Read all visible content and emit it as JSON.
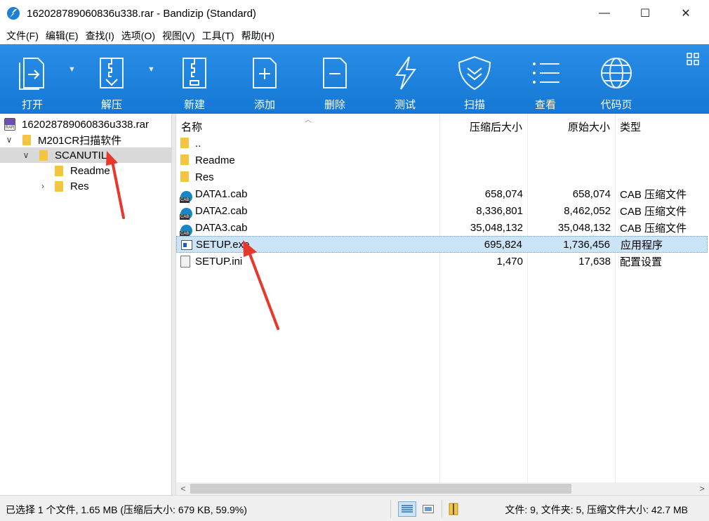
{
  "window": {
    "title": "162028789060836u338.rar - Bandizip (Standard)",
    "min_glyph": "—",
    "max_glyph": "☐",
    "close_glyph": "✕"
  },
  "menu": [
    "文件(F)",
    "编辑(E)",
    "查找(I)",
    "选项(O)",
    "视图(V)",
    "工具(T)",
    "帮助(H)"
  ],
  "toolbar": {
    "open": "打开",
    "extract": "解压",
    "new": "新建",
    "add": "添加",
    "delete": "删除",
    "test": "测试",
    "scan": "扫描",
    "view": "查看",
    "codepage": "代码页"
  },
  "tree": {
    "archive": "162028789060836u338.rar",
    "root_folder": "M201CR扫描软件",
    "selected_folder": "SCANUTIL",
    "children": [
      "Readme",
      "Res"
    ]
  },
  "columns": {
    "name": "名称",
    "compressed": "压缩后大小",
    "original": "原始大小",
    "type": "类型"
  },
  "files": [
    {
      "name": "..",
      "compressed": "",
      "original": "",
      "type": "",
      "icon": "folder"
    },
    {
      "name": "Readme",
      "compressed": "",
      "original": "",
      "type": "",
      "icon": "folder"
    },
    {
      "name": "Res",
      "compressed": "",
      "original": "",
      "type": "",
      "icon": "folder"
    },
    {
      "name": "DATA1.cab",
      "compressed": "658,074",
      "original": "658,074",
      "type": "CAB 压缩文件",
      "icon": "cab"
    },
    {
      "name": "DATA2.cab",
      "compressed": "8,336,801",
      "original": "8,462,052",
      "type": "CAB 压缩文件",
      "icon": "cab"
    },
    {
      "name": "DATA3.cab",
      "compressed": "35,048,132",
      "original": "35,048,132",
      "type": "CAB 压缩文件",
      "icon": "cab"
    },
    {
      "name": "SETUP.exe",
      "compressed": "695,824",
      "original": "1,736,456",
      "type": "应用程序",
      "icon": "exe"
    },
    {
      "name": "SETUP.ini",
      "compressed": "1,470",
      "original": "17,638",
      "type": "配置设置",
      "icon": "ini"
    }
  ],
  "status": {
    "left": "已选择 1 个文件, 1.65 MB (压缩后大小: 679 KB, 59.9%)",
    "right": "文件: 9, 文件夹: 5, 压缩文件大小: 42.7 MB"
  },
  "colors": {
    "toolbar": "#1e84de",
    "selection": "#cce4f7",
    "annotation_arrow": "#e8372b"
  }
}
